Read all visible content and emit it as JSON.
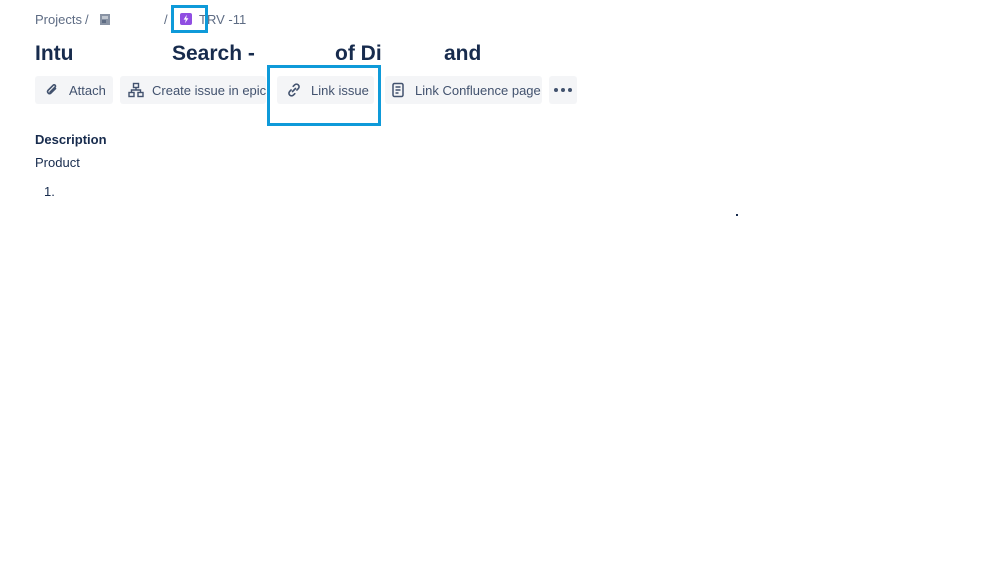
{
  "breadcrumb": {
    "projects_label": "Projects",
    "separator": "/",
    "project_avatar_icon": "project-avatar-icon",
    "project_name": "",
    "issue_type_icon": "epic-lightning-icon",
    "issue_type_color": "#904ee2",
    "issue_key": "TRV  -11"
  },
  "issue": {
    "title_parts": [
      "Intu",
      "Search -",
      "of Di",
      "and"
    ]
  },
  "toolbar": {
    "attach_label": "Attach",
    "attach_icon": "paperclip-icon",
    "create_in_epic_label": "Create issue in epic",
    "create_in_epic_icon": "hierarchy-icon",
    "link_issue_label": "Link issue",
    "link_issue_icon": "link-icon",
    "link_confluence_label": "Link Confluence page",
    "link_confluence_icon": "page-icon",
    "more_icon": "more-horizontal-icon"
  },
  "description": {
    "label": "Description",
    "text": "Product",
    "list_marker": "1."
  },
  "colors": {
    "highlight": "#0e9ad9",
    "text_primary": "#172b4d",
    "text_secondary": "#5e6c84",
    "button_bg": "#f4f5f7",
    "button_text": "#42526e"
  }
}
